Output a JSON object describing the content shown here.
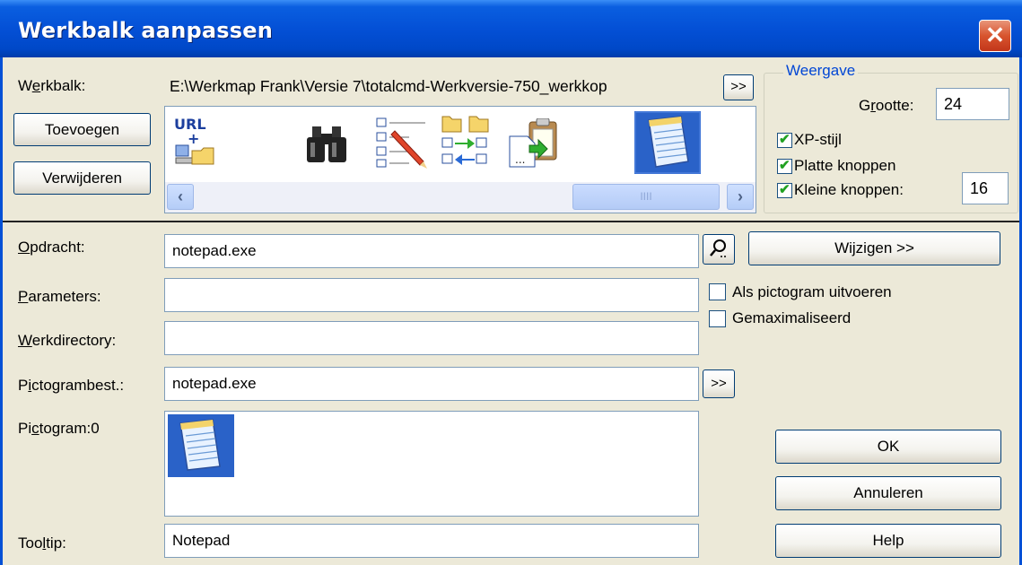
{
  "window": {
    "title": "Werkbalk aanpassen"
  },
  "toolbar_row": {
    "label": "Werkbalk:",
    "path": "E:\\Werkmap Frank\\Versie 7\\totalcmd-Werkversie-750_werkkop",
    "browse_label": ">>",
    "add_label": "Toevoegen",
    "remove_label": "Verwijderen",
    "icons": [
      "url-icon",
      "binoculars-icon",
      "edit-list-icon",
      "compare-dirs-icon",
      "copy-names-icon",
      "notepad-icon"
    ],
    "scroll_thumb_grip": "IIII"
  },
  "display": {
    "legend": "Weergave",
    "size_label": "Grootte:",
    "size_value": "24",
    "xp_style_label": "XP-stijl",
    "xp_style_checked": true,
    "flat_buttons_label": "Platte knoppen",
    "flat_buttons_checked": true,
    "small_buttons_label": "Kleine knoppen:",
    "small_buttons_checked": true,
    "small_size_value": "16"
  },
  "command": {
    "label": "Opdracht:",
    "value": "notepad.exe",
    "change_label": "Wijzigen >>"
  },
  "parameters": {
    "label": "Parameters:",
    "value": "",
    "run_minimized_label": "Als pictogram uitvoeren",
    "run_minimized_checked": false,
    "maximized_label": "Gemaximaliseerd",
    "maximized_checked": false
  },
  "workdir": {
    "label": "Werkdirectory:",
    "value": ""
  },
  "iconfile": {
    "label": "Pictogrambest.:",
    "value": "notepad.exe",
    "browse_label": ">>"
  },
  "icon": {
    "label": "Pictogram:0"
  },
  "tooltip": {
    "label": "Tooltip:",
    "value": "Notepad"
  },
  "buttons": {
    "ok": "OK",
    "cancel": "Annuleren",
    "help": "Help"
  },
  "colors": {
    "title_bar": "#0450d6",
    "dialog_bg": "#ece9d8",
    "legend_text": "#0046d5",
    "close_button": "#d8542e"
  }
}
